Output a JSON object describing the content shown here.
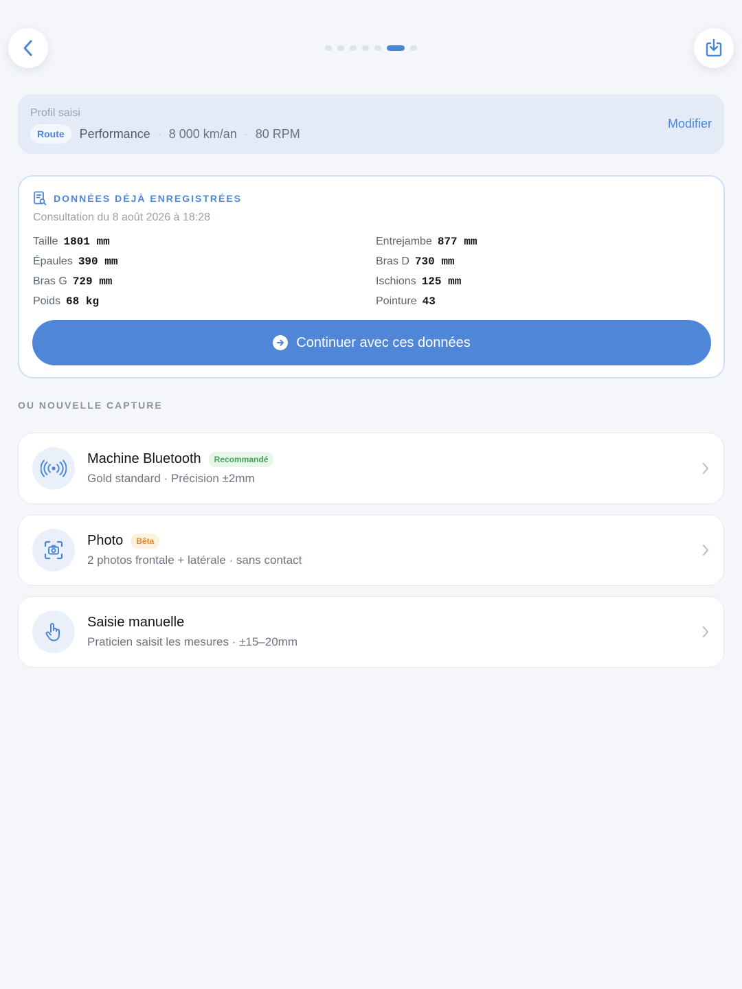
{
  "topbar": {
    "back_icon": "chevron-left-icon",
    "export_icon": "download-tray-icon",
    "steps": [
      false,
      false,
      false,
      false,
      false,
      true,
      false
    ]
  },
  "profile": {
    "label": "Profil saisi",
    "discipline": "Route",
    "level": "Performance",
    "distance": "8 000 km/an",
    "cadence": "80 RPM",
    "separator": "·",
    "modify_label": "Modifier"
  },
  "saved": {
    "title": "DONNÉES DÉJÀ ENREGISTRÉES",
    "subtitle": "Consultation du 8 août 2026 à 18:28",
    "measures": [
      {
        "label": "Taille",
        "value": "1801 mm"
      },
      {
        "label": "Entrejambe",
        "value": "877 mm"
      },
      {
        "label": "Épaules",
        "value": "390 mm"
      },
      {
        "label": "Bras D",
        "value": "730 mm"
      },
      {
        "label": "Bras G",
        "value": "729 mm"
      },
      {
        "label": "Ischions",
        "value": "125 mm"
      },
      {
        "label": "Poids",
        "value": "68 kg"
      },
      {
        "label": "Pointure",
        "value": "43"
      }
    ],
    "continue_label": "Continuer avec ces données"
  },
  "new_capture": {
    "section_label": "OU NOUVELLE CAPTURE",
    "options": [
      {
        "title": "Machine Bluetooth",
        "badge": "Recommandé",
        "subtitle": "Gold standard · Précision ±2mm",
        "icon": "bluetooth-signal-icon"
      },
      {
        "title": "Photo",
        "badge": "Bêta",
        "subtitle": "2 photos frontale + latérale · sans contact",
        "icon": "camera-scan-icon"
      },
      {
        "title": "Saisie manuelle",
        "badge": "",
        "subtitle": "Praticien saisit les mesures · ±15–20mm",
        "icon": "hand-pointer-icon"
      }
    ]
  },
  "colors": {
    "accent": "#4a86d8",
    "badge_green": "#46a257",
    "badge_orange": "#d98a2a",
    "background": "#f4f6fa"
  }
}
